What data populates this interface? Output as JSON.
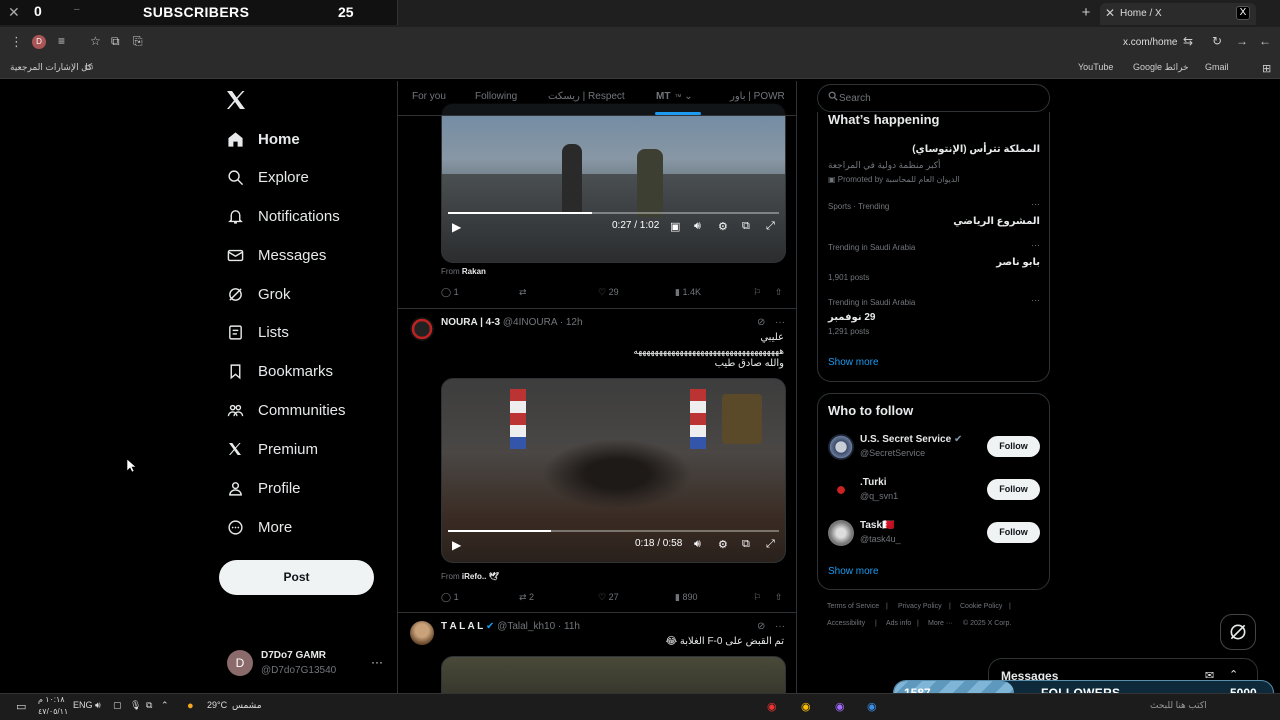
{
  "overlay": {
    "close": "✕",
    "subscribers_count": "0",
    "subscribers_label": "SUBSCRIBERS",
    "subscribers_goal": "25",
    "followers_current": "1587",
    "followers_label": "FOLLOWERS",
    "followers_goal": "5000",
    "followers_fraction": 0.317
  },
  "browser": {
    "tab_title": "Home / X",
    "url": "x.com/home",
    "bookmarks_all": "كل الإشارات المرجعية",
    "bookmarks": [
      "YouTube",
      "Google خرائط",
      "Gmail"
    ]
  },
  "nav": {
    "items": [
      {
        "label": "Home",
        "icon": "home-icon"
      },
      {
        "label": "Explore",
        "icon": "search-icon"
      },
      {
        "label": "Notifications",
        "icon": "bell-icon"
      },
      {
        "label": "Messages",
        "icon": "envelope-icon"
      },
      {
        "label": "Grok",
        "icon": "grok-icon"
      },
      {
        "label": "Lists",
        "icon": "list-icon"
      },
      {
        "label": "Bookmarks",
        "icon": "bookmark-icon"
      },
      {
        "label": "Communities",
        "icon": "people-icon"
      },
      {
        "label": "Premium",
        "icon": "x-icon"
      },
      {
        "label": "Profile",
        "icon": "person-icon"
      },
      {
        "label": "More",
        "icon": "more-circle-icon"
      }
    ],
    "post_label": "Post",
    "account": {
      "avatar": "D",
      "name": "D7Do7 GAMR",
      "handle": "@D7do7G13540"
    }
  },
  "feed": {
    "tabs": [
      "For you",
      "Following",
      "ريسكت | Respect",
      "MT",
      "باور | POWR"
    ],
    "active_tab_suffix": "™",
    "tweet1": {
      "video_time": "0:27 / 1:02",
      "video_progress": 0.435,
      "from_label": "From",
      "from_name": "Rakan",
      "replies": "1",
      "likes": "29",
      "views": "1.4K"
    },
    "tweet2": {
      "name": "NOURA | 4-3",
      "handle": "@4INOURA",
      "time": "· 12h",
      "line1": "عليبي",
      "line2": "هههههههههههههههههههههههههههههههههههه",
      "line3": "والله صادق طيب",
      "video_time": "0:18 / 0:58",
      "video_progress": 0.31,
      "from_label": "From",
      "from_name": "iRefo.. 🕊",
      "replies": "1",
      "reposts": "2",
      "likes": "27",
      "views": "890"
    },
    "tweet3": {
      "name": "T A L A L",
      "handle": "@Talal_kh10",
      "time": "· 11h",
      "text": "تم القبض على F-0 الغلابة 😂"
    }
  },
  "sidebar": {
    "search_placeholder": "Search",
    "happening_title": "What’s happening",
    "promo": {
      "topic": "المملكة تترأس (الإنتوساي)",
      "desc": "أكبر منظمة دولية في المراجعة",
      "promoted": "Promoted by",
      "promoter": "الديوان العام للمحاسبة"
    },
    "trends": [
      {
        "meta": "Sports · Trending",
        "topic": "المشروع الرياضي",
        "posts": ""
      },
      {
        "meta": "Trending in Saudi Arabia",
        "topic": "بابو ناصر",
        "posts": "1,901 posts"
      },
      {
        "meta": "Trending in Saudi Arabia",
        "topic": "29 نوفمبر",
        "posts": "1,291 posts"
      }
    ],
    "show_more": "Show more",
    "who_to_follow_title": "Who to follow",
    "who_to_follow": [
      {
        "name": "U.S. Secret Service",
        "handle": "@SecretService",
        "button": "Follow"
      },
      {
        "name": ".Turki",
        "handle": "@q_svn1",
        "button": "Follow"
      },
      {
        "name": "Task🇧🇭",
        "handle": "@task4u_",
        "button": "Follow"
      }
    ],
    "show_more_2": "Show more",
    "footer": [
      "Terms of Service",
      "|",
      "Privacy Policy",
      "|",
      "Cookie Policy",
      "|",
      "Accessibility",
      "|",
      "Ads info",
      "|",
      "More ···",
      "© 2025 X Corp."
    ],
    "messages_label": "Messages"
  },
  "taskbar": {
    "time": "١٠:١٨ م",
    "date": "٤٧/٠٥/١١",
    "lang": "ENG",
    "weather_temp": "29°C",
    "weather_label": "مشمس",
    "search": "اكتب هنا للبحث"
  }
}
